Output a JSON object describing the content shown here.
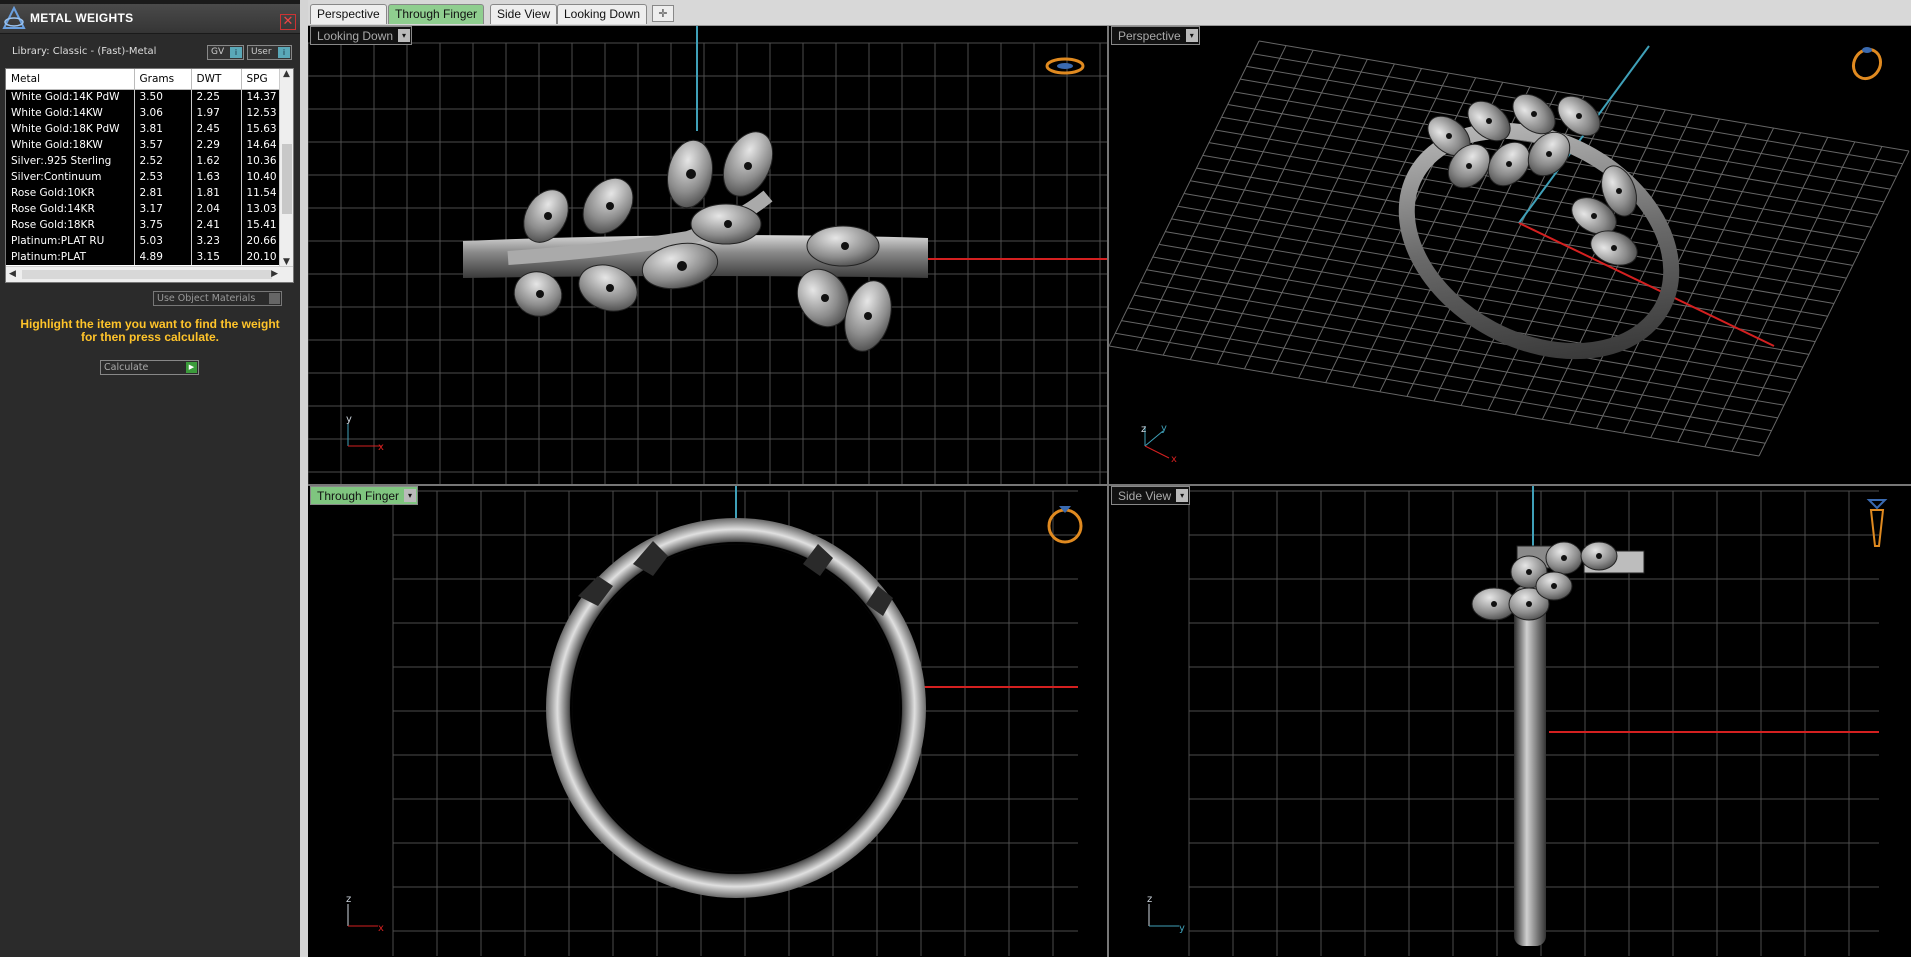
{
  "panel": {
    "title": "METAL WEIGHTS",
    "close_symbol": "✕",
    "library_label": "Library: Classic - (Fast)-Metal",
    "gv_label": "GV",
    "user_label": "User",
    "toggle_symbol": "i",
    "columns": [
      "Metal",
      "Grams",
      "DWT",
      "SPG"
    ],
    "rows": [
      [
        "White Gold:14K PdW",
        "3.50",
        "2.25",
        "14.37"
      ],
      [
        "White Gold:14KW",
        "3.06",
        "1.97",
        "12.53"
      ],
      [
        "White Gold:18K PdW",
        "3.81",
        "2.45",
        "15.63"
      ],
      [
        "White Gold:18KW",
        "3.57",
        "2.29",
        "14.64"
      ],
      [
        "Silver:.925 Sterling",
        "2.52",
        "1.62",
        "10.36"
      ],
      [
        "Silver:Continuum",
        "2.53",
        "1.63",
        "10.40"
      ],
      [
        "Rose Gold:10KR",
        "2.81",
        "1.81",
        "11.54"
      ],
      [
        "Rose Gold:14KR",
        "3.17",
        "2.04",
        "13.03"
      ],
      [
        "Rose Gold:18KR",
        "3.75",
        "2.41",
        "15.41"
      ],
      [
        "Platinum:PLAT RU",
        "5.03",
        "3.23",
        "20.66"
      ],
      [
        "Platinum:PLAT",
        "4.89",
        "3.15",
        "20.10"
      ]
    ],
    "use_materials_label": "Use Object Materials",
    "instruction_line1": "Highlight the item you want to find the weight",
    "instruction_line2": "for then press calculate.",
    "calculate_label": "Calculate",
    "calculate_symbol": "▶"
  },
  "tabs": [
    {
      "label": "Perspective",
      "active": false
    },
    {
      "label": "Through Finger",
      "active": true
    },
    {
      "label": "Side View",
      "active": false
    },
    {
      "label": "Looking Down",
      "active": false
    }
  ],
  "tab_add_symbol": "✛",
  "viewports": {
    "top_left": {
      "label": "Looking Down",
      "axes": [
        "y",
        "x"
      ]
    },
    "top_right": {
      "label": "Perspective",
      "axes": [
        "z",
        "y",
        "x"
      ]
    },
    "bottom_left": {
      "label": "Through Finger",
      "axes": [
        "z",
        "x"
      ]
    },
    "bottom_right": {
      "label": "Side View",
      "axes": [
        "z",
        "y"
      ]
    }
  },
  "dropdown_symbol": "▾",
  "colors": {
    "active_tab": "#8fce8f",
    "instruction_text": "#ffc42a",
    "axis_x": "#d42020",
    "axis_y": "#3fa0b8"
  }
}
